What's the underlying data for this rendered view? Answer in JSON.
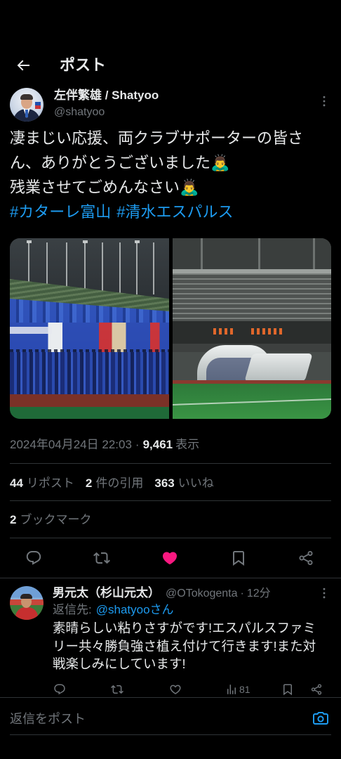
{
  "header": {
    "title": "ポスト"
  },
  "icons": {
    "back": "arrow-left-icon",
    "more": "more-vertical-icon",
    "reply": "reply-icon",
    "repost": "repost-icon",
    "like": "heart-icon",
    "bookmark": "bookmark-icon",
    "share": "share-icon",
    "views": "views-icon",
    "camera": "camera-icon"
  },
  "colors": {
    "background": "#000000",
    "text": "#e7e9ea",
    "muted": "#71767b",
    "accent": "#1d9bf0",
    "like": "#f91880",
    "divider": "#2f3336"
  },
  "post": {
    "author": {
      "name": "左伴繁雄 / Shatyoo",
      "handle": "@shatyoo"
    },
    "text_lines": [
      "凄まじい応援、両クラブサポーターの皆さ",
      "ん、ありがとうございました🙇‍♂️",
      "残業させてごめんなさい🙇‍♂️"
    ],
    "hashtags": [
      "#カターレ富山",
      "#清水エスパルス"
    ],
    "timestamp": "2024年04月24日 22:03",
    "separator": "·",
    "views": {
      "count": "9,461",
      "label": "表示"
    },
    "stats": {
      "reposts": {
        "count": "44",
        "label": "リポスト"
      },
      "quotes": {
        "count": "2",
        "label": "件の引用"
      },
      "likes": {
        "count": "363",
        "label": "いいね"
      },
      "bookmarks": {
        "count": "2",
        "label": "ブックマーク"
      }
    },
    "liked": true
  },
  "reply": {
    "author": {
      "name": "男元太（杉山元太）",
      "handle": "@OTokogenta"
    },
    "separator": "·",
    "time": "12分",
    "replying_to": {
      "label": "返信先:",
      "handle": "@shatyooさん"
    },
    "text_lines": [
      "素晴らしい粘りさすがです!エスパルスファミ",
      "リー共々勝負強さ植え付けて行きます!また対",
      "戦楽しみにしています!"
    ],
    "views": "81"
  },
  "composer": {
    "placeholder": "返信をポスト"
  }
}
